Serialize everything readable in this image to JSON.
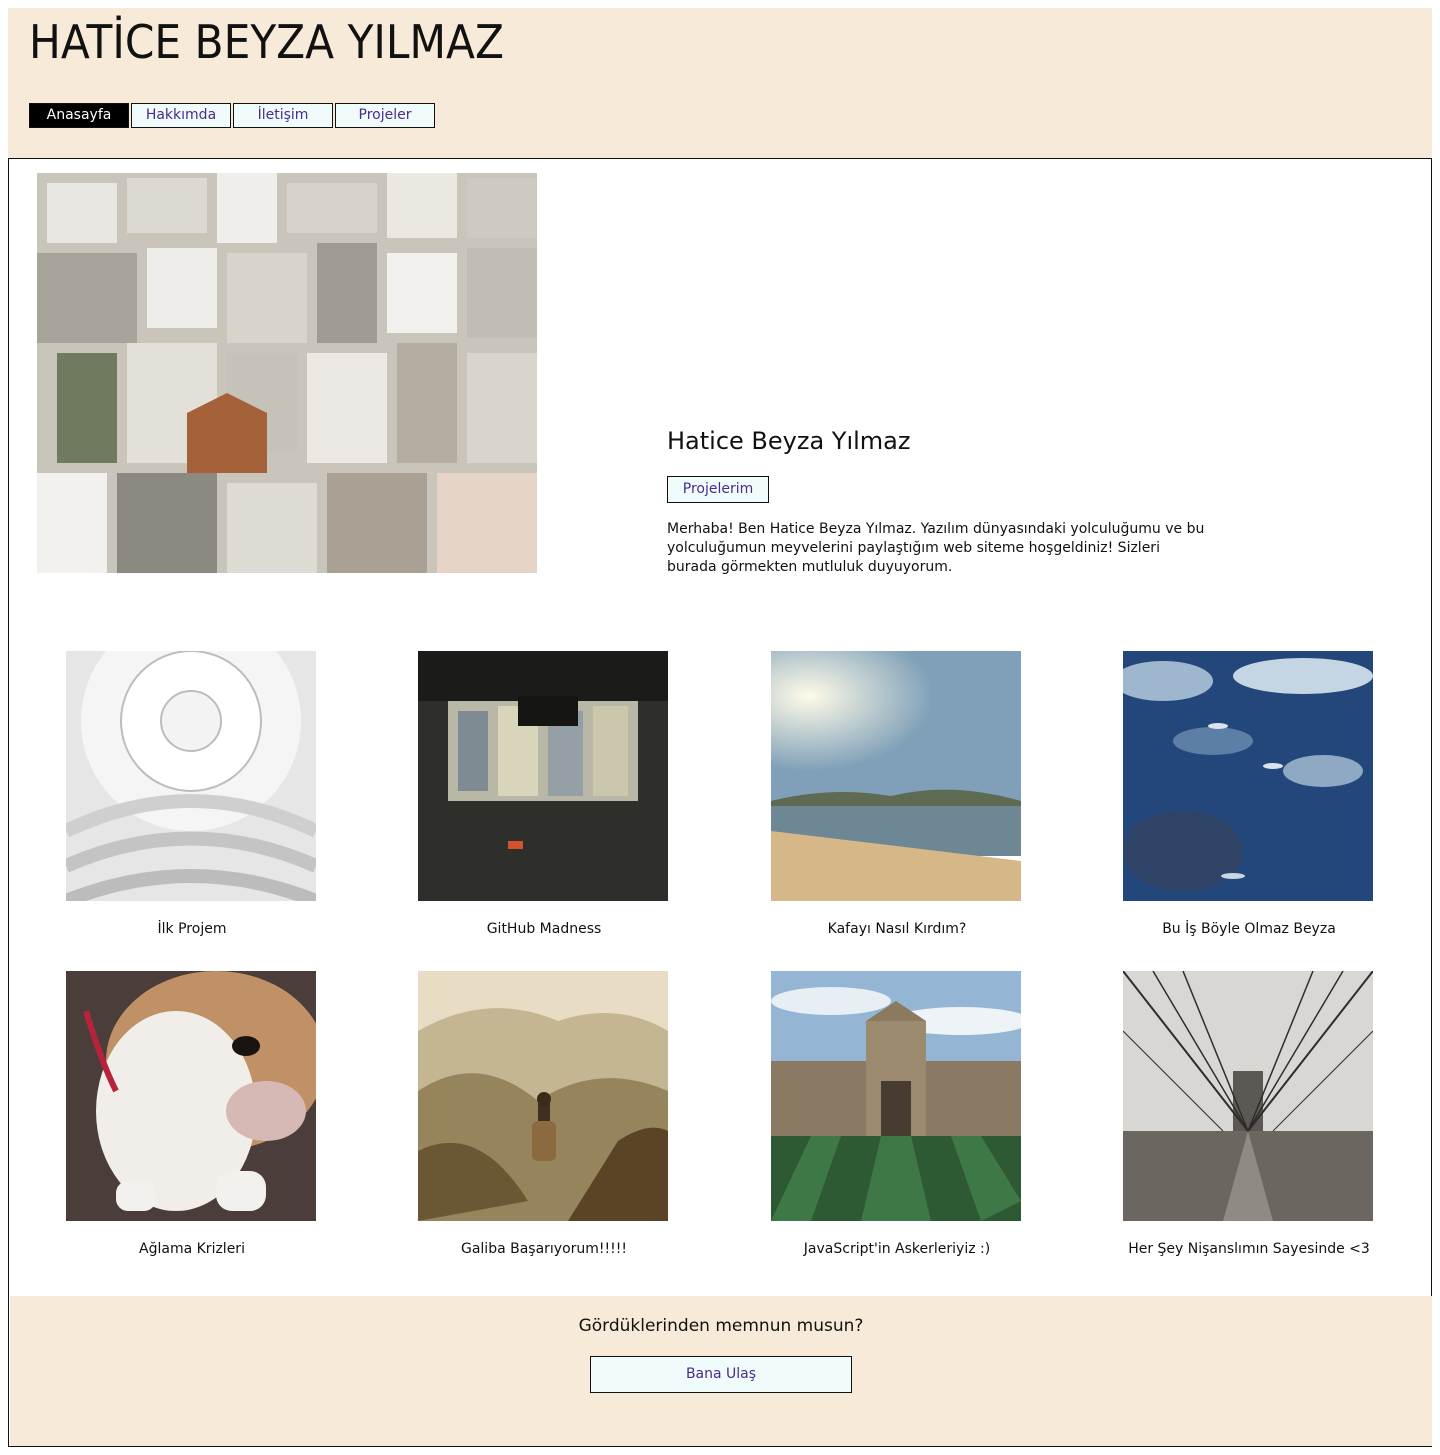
{
  "header": {
    "title": "HATİCE BEYZA YILMAZ",
    "nav": [
      {
        "label": "Anasayfa",
        "active": true
      },
      {
        "label": "Hakkımda",
        "active": false
      },
      {
        "label": "İletişim",
        "active": false
      },
      {
        "label": "Projeler",
        "active": false
      }
    ]
  },
  "intro": {
    "name": "Hatice Beyza Yılmaz",
    "button_label": "Projelerim",
    "text": "Merhaba! Ben Hatice Beyza Yılmaz. Yazılım dünyasındaki yolculuğumu ve bu yolculuğumun meyvelerini paylaştığım web siteme hoşgeldiniz! Sizleri burada görmekten mutluluk duyuyorum."
  },
  "projects": [
    {
      "caption": "İlk Projem",
      "image": "museum-rotunda-photo"
    },
    {
      "caption": "GitHub Madness",
      "image": "city-reflection-photo"
    },
    {
      "caption": "Kafayı Nasıl Kırdım?",
      "image": "beach-sunrise-photo"
    },
    {
      "caption": "Bu İş Böyle Olmaz Beyza",
      "image": "ocean-fish-photo"
    },
    {
      "caption": "Ağlama Krizleri",
      "image": "bulldog-photo"
    },
    {
      "caption": "Galiba Başarıyorum!!!!!",
      "image": "mountain-hiker-photo"
    },
    {
      "caption": "JavaScript'in Askerleriyiz :)",
      "image": "college-building-photo"
    },
    {
      "caption": "Her Şey Nişanslımın Sayesinde <3",
      "image": "suspension-bridge-photo"
    }
  ],
  "footer": {
    "question": "Gördüklerinden memnun musun?",
    "button_label": "Bana Ulaş"
  },
  "colors": {
    "header_bg": "#f8ead8",
    "button_bg": "#effcfb",
    "link_text": "#4b2a8c",
    "active_bg": "#000000"
  }
}
